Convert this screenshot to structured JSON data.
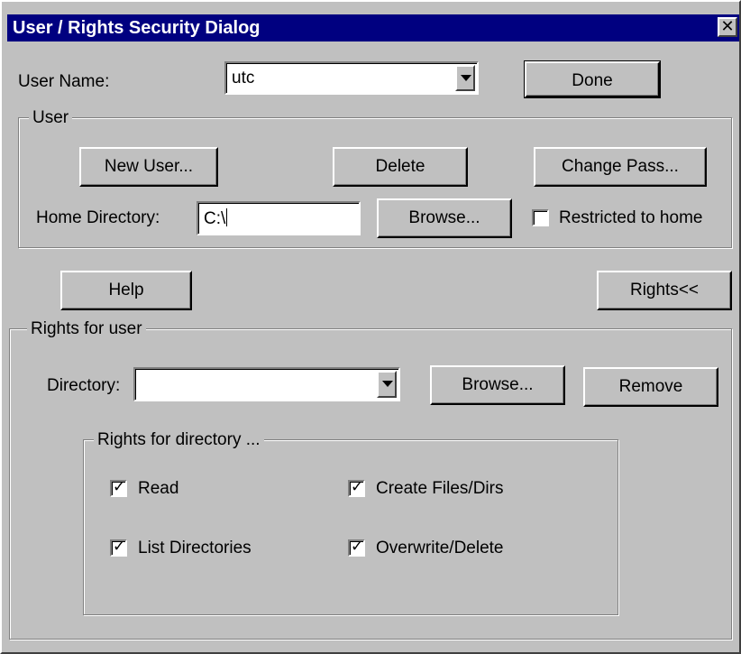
{
  "window": {
    "title": "User / Rights Security Dialog",
    "close_glyph": "✕"
  },
  "user_name": {
    "label": "User Name:",
    "value": "utc"
  },
  "done_label": "Done",
  "user_group": {
    "legend": "User",
    "new_user_label": "New User...",
    "delete_label": "Delete",
    "change_pass_label": "Change Pass...",
    "home_dir_label": "Home Directory:",
    "home_dir_value": "C:\\",
    "browse_label": "Browse...",
    "restricted_label": "Restricted to home",
    "restricted_checked": false
  },
  "help_label": "Help",
  "rights_toggle_label": "Rights<<",
  "rights_group": {
    "legend": "Rights for user",
    "directory_label": "Directory:",
    "directory_value": "",
    "browse_label": "Browse...",
    "remove_label": "Remove",
    "dir_rights": {
      "legend": "Rights for directory ...",
      "read": {
        "label": "Read",
        "checked": true
      },
      "create": {
        "label": "Create Files/Dirs",
        "checked": true
      },
      "list": {
        "label": "List Directories",
        "checked": true
      },
      "overwrite": {
        "label": "Overwrite/Delete",
        "checked": true
      }
    }
  },
  "check_glyph": "✓",
  "colors": {
    "titlebar": "#000080",
    "face": "#c0c0c0"
  }
}
